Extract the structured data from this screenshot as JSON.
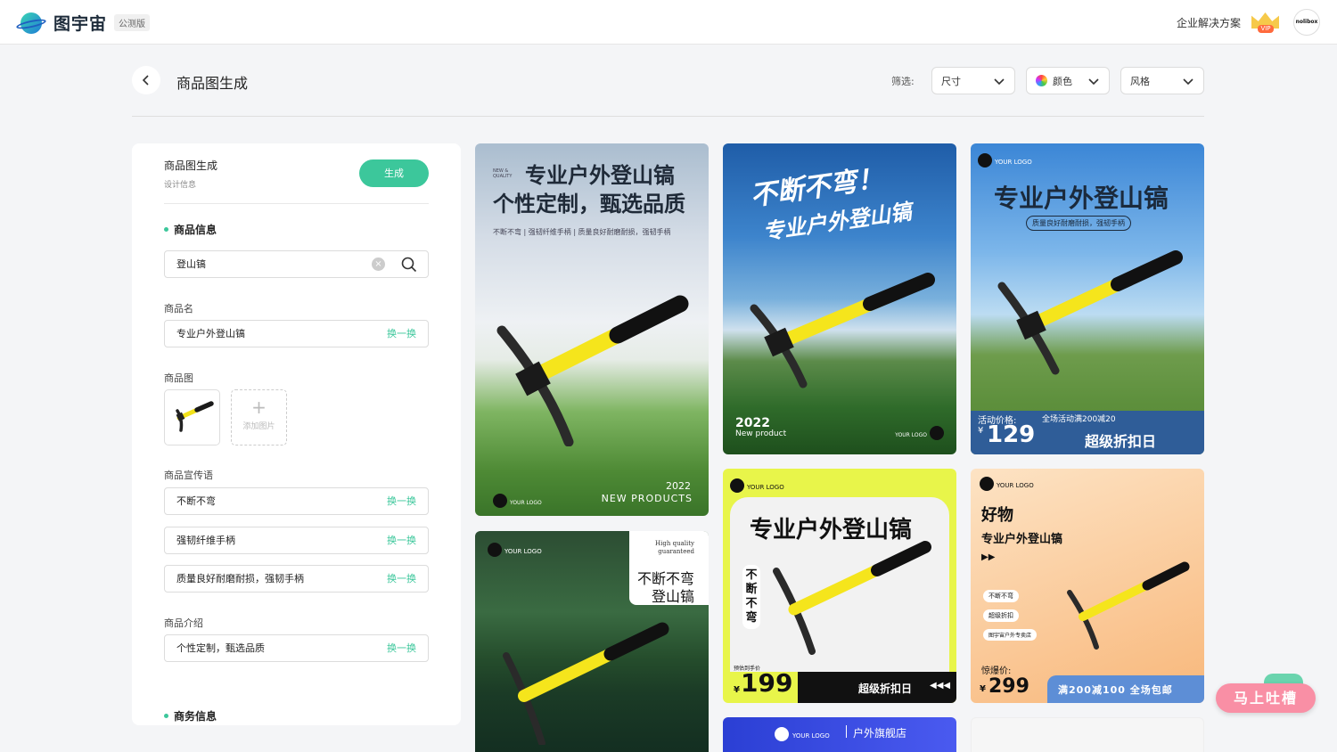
{
  "app": {
    "name": "图宇宙",
    "badge": "公测版"
  },
  "topnav": {
    "enterprise_link": "企业解决方案",
    "vip_label": "VIP",
    "avatar_text": "nolibox"
  },
  "header": {
    "title": "商品图生成",
    "filter_label": "筛选:",
    "filters": [
      {
        "label": "尺寸"
      },
      {
        "label": "颜色"
      },
      {
        "label": "风格"
      }
    ]
  },
  "panel": {
    "title": "商品图生成",
    "subtitle": "设计信息",
    "generate_label": "生成",
    "section_product": "商品信息",
    "search_value": "登山镐",
    "name_label": "商品名",
    "name_value": "专业户外登山镐",
    "swap_label": "换一换",
    "image_label": "商品图",
    "add_image_label": "添加图片",
    "slogan_label": "商品宣传语",
    "slogans": [
      "不断不弯",
      "强韧纤维手柄",
      "质量良好耐磨耐损，强韧手柄"
    ],
    "intro_label": "商品介绍",
    "intro_value": "个性定制，甄选品质",
    "section_business": "商务信息"
  },
  "cards": {
    "c1": {
      "newq": "NEW & QUALITY",
      "title1": "专业户外登山镐",
      "title2": "个性定制，甄选品质",
      "tagline": "不断不弯 | 强韧纤维手柄 | 质量良好耐磨耐损，强韧手柄",
      "year": "2022",
      "new_products": "NEW PRODUCTS",
      "logo": "YOUR LOGO"
    },
    "c2": {
      "title1": "不断不弯！",
      "title2": "专业户外登山镐",
      "year": "2022",
      "new_product": "New product",
      "logo": "YOUR LOGO"
    },
    "c3": {
      "logo": "YOUR LOGO",
      "logo_url": "WWW.YOURLOGO.COM",
      "title": "专业户外登山镐",
      "subtitle": "质量良好耐磨耐损，强韧手柄",
      "price_label": "活动价格:",
      "promo": "全场活动满200减20",
      "price": "129",
      "currency": "¥",
      "sale": "超级折扣日"
    },
    "c4": {
      "logo": "YOUR LOGO",
      "hq": "High quality guaranteed",
      "title1": "不断不弯",
      "title2": "登山镐"
    },
    "c5": {
      "logo": "YOUR LOGO",
      "title": "专业户外登山镐",
      "vertical": "不断不弯",
      "price_label": "预估到手价",
      "currency": "¥",
      "price": "199",
      "sale": "超级折扣日"
    },
    "c6": {
      "logo": "YOUR LOGO",
      "logo_url": "WWW.YOURLOGO.COM",
      "title": "好物",
      "subtitle": "专业户外登山镐",
      "tag1": "不断不弯",
      "tag2": "超级折扣",
      "tag3": "图宇宙户外专卖店",
      "price_label": "惊爆价:",
      "currency": "¥",
      "price": "299",
      "promo": "满200减100 全场包邮"
    },
    "c7": {
      "logo": "YOUR LOGO",
      "store": "户外旗舰店"
    }
  },
  "feedback": {
    "label": "马上吐槽"
  },
  "colors": {
    "accent": "#3cc79b",
    "feedback": "#f98fa5"
  }
}
